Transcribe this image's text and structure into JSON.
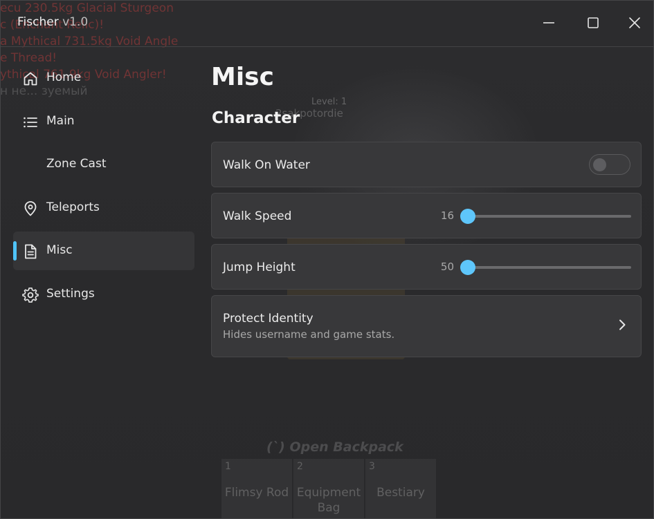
{
  "window": {
    "app_name": "Fischer",
    "version": "v1.0"
  },
  "sidebar": {
    "items": [
      {
        "label": "Home",
        "icon": "home-icon"
      },
      {
        "label": "Main",
        "icon": "list-icon"
      },
      {
        "label": "Zone Cast",
        "icon": ""
      },
      {
        "label": "Teleports",
        "icon": "map-pin-icon"
      },
      {
        "label": "Misc",
        "icon": "document-icon",
        "active": true
      },
      {
        "label": "Settings",
        "icon": "gear-icon"
      }
    ],
    "accent_color": "#4fc3f7"
  },
  "main": {
    "page_title": "Misc",
    "section_title": "Character",
    "walk_on_water": {
      "label": "Walk On Water",
      "enabled": false
    },
    "walk_speed": {
      "label": "Walk Speed",
      "value": "16"
    },
    "jump_height": {
      "label": "Jump Height",
      "value": "50"
    },
    "protect_identity": {
      "label": "Protect Identity",
      "description": "Hides username and game stats."
    }
  },
  "background": {
    "chat_lines": [
      "ecu 230.5kg Glacial Sturgeon",
      "c (Enchant Relic)!",
      "a Mythical 731.5kg Void Angle",
      "e Thread!",
      "ythical 761.9kg Void Angler!",
      "н не... зуемый"
    ],
    "player_level": "Level: 1",
    "player_name": "2sakpotordie",
    "backpack_hint": "(`) Open Backpack",
    "hotbar": [
      {
        "num": "1",
        "name": "Flimsy Rod"
      },
      {
        "num": "2",
        "name": "Equipment Bag"
      },
      {
        "num": "3",
        "name": "Bestiary"
      }
    ]
  }
}
